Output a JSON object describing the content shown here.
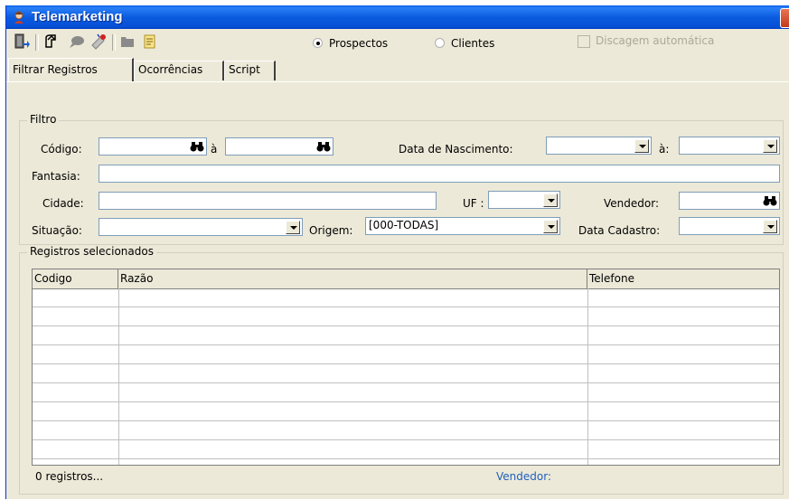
{
  "window": {
    "title": "Telemarketing",
    "icon": "app-user-icon"
  },
  "toolbar": {
    "buttons": [
      "exit-door-icon",
      "refresh-arrow-icon",
      "speech-bubble-icon",
      "phone-call-icon",
      "folder-icon",
      "notes-icon"
    ],
    "radio_prospectos": "Prospectos",
    "radio_clientes": "Clientes",
    "selected": "Prospectos",
    "auto_dial_label": "Discagem automática"
  },
  "tabs": [
    "Filtrar Registros",
    "Ocorrências",
    "Script"
  ],
  "filter": {
    "group_label": "Filtro",
    "codigo_label": "Código:",
    "a_label": "à",
    "nascimento_label": "Data de Nascimento:",
    "nascimento_a_label": "à:",
    "fantasia_label": "Fantasia:",
    "cidade_label": "Cidade:",
    "uf_label": "UF :",
    "vendedor_label": "Vendedor:",
    "situacao_label": "Situação:",
    "origem_label": "Origem:",
    "origem_value": "[000-TODAS]",
    "cadastro_label": "Data Cadastro:"
  },
  "records": {
    "group_label": "Registros selecionados",
    "columns": [
      "Codigo",
      "Razão",
      "Telefone"
    ],
    "count_text": "0 registros...",
    "vendedor_text": "Vendedor:"
  },
  "colors": {
    "title_bar": "#0a5fe6",
    "window_bg": "#ece9d8",
    "accent_text": "#2060c0"
  }
}
